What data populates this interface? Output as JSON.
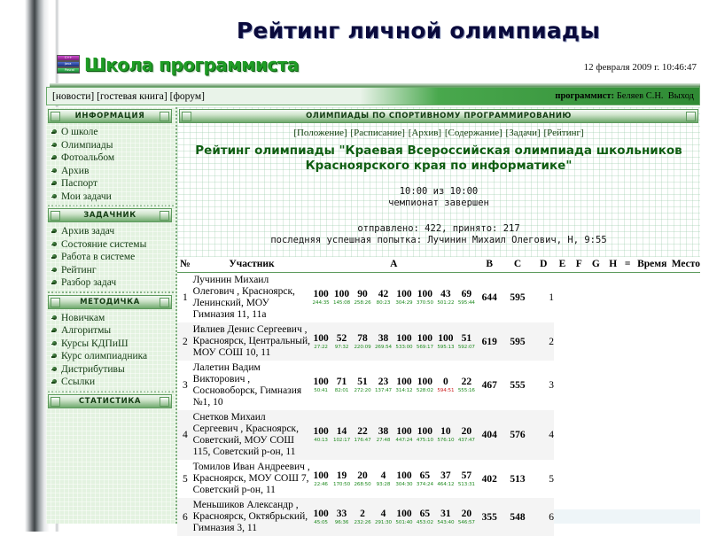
{
  "header": {
    "big_title": "Рейтинг личной олимпиады",
    "site_name": "Школа программиста",
    "datetime": "12 февраля 2009 г. 10:46:47",
    "logo_books": [
      "C++",
      "Java",
      "Pascal"
    ]
  },
  "topbar": {
    "left_links": "[новости] [гостевая книга] [форум]",
    "role_label": "программист:",
    "user_name": "Беляев С.Н.",
    "logout_label": "Выход"
  },
  "sidebar": {
    "sections": [
      {
        "title": "ИНФОРМАЦИЯ",
        "items": [
          "О школе",
          "Олимпиады",
          "Фотоальбом",
          "Архив",
          "Паспорт",
          "Мои задачи"
        ]
      },
      {
        "title": "ЗАДАЧНИК",
        "items": [
          "Архив задач",
          "Состояние системы",
          "Работа в системе",
          "Рейтинг",
          "Разбор задач"
        ]
      },
      {
        "title": "МЕТОДИЧКА",
        "items": [
          "Новичкам",
          "Алгоритмы",
          "Курсы КДПиШ",
          "Курс олимпиадника",
          "Дистрибутивы",
          "Ссылки"
        ]
      },
      {
        "title": "СТАТИСТИКА",
        "items": []
      }
    ]
  },
  "main": {
    "section_title": "ОЛИМПИАДЫ ПО СПОРТИВНОМУ ПРОГРАММИРОВАНИЮ",
    "subnav": [
      "[Положение]",
      "[Расписание]",
      "[Архив]",
      "[Содержание]",
      "[Задачи]",
      "[Рейтинг]"
    ],
    "olympiad_title": "Рейтинг олимпиады \"Краевая Всероссийская олимпиада школьников Красноярского края по информатике\"",
    "clock": "10:00 из 10:00",
    "status": "чемпионат завершен",
    "submissions": "отправлено: 422, принято: 217",
    "last_accepted": "последняя успешная попытка: Лучинин Михаил Олегович, H, 9:55"
  },
  "table": {
    "columns": [
      "№",
      "Участник",
      "A",
      "B",
      "C",
      "D",
      "E",
      "F",
      "G",
      "H",
      "=",
      "Время",
      "Место"
    ],
    "rows": [
      {
        "num": "1",
        "participant": "Лучинин Михаил Олегович , Красноярск, Ленинский, МОУ Гимназия 11, 11а",
        "scores": [
          "100",
          "100",
          "90",
          "42",
          "100",
          "100",
          "43",
          "69"
        ],
        "times": [
          "244:35",
          "145:08",
          "258:26",
          "80:23",
          "304:29",
          "370:50",
          "501:22",
          "595:44"
        ],
        "times_bad": [
          false,
          false,
          false,
          false,
          false,
          false,
          false,
          false
        ],
        "total": "644",
        "time": "595",
        "place": "1"
      },
      {
        "num": "2",
        "participant": "Ивлиев Денис Сергеевич , Красноярск, Центральный, МОУ СОШ 10, 11",
        "scores": [
          "100",
          "52",
          "78",
          "38",
          "100",
          "100",
          "100",
          "51"
        ],
        "times": [
          "27:22",
          "97:32",
          "220:09",
          "269:54",
          "533:00",
          "569:17",
          "595:13",
          "592:07"
        ],
        "times_bad": [
          false,
          false,
          false,
          false,
          false,
          false,
          false,
          false
        ],
        "total": "619",
        "time": "595",
        "place": "2"
      },
      {
        "num": "3",
        "participant": "Лалетин Вадим Викторович , Сосновоборск, Гимназия №1, 10",
        "scores": [
          "100",
          "71",
          "51",
          "23",
          "100",
          "100",
          "0",
          "22"
        ],
        "times": [
          "50:41",
          "82:01",
          "272:20",
          "137:47",
          "314:12",
          "528:02",
          "594:51",
          "555:16"
        ],
        "times_bad": [
          false,
          false,
          false,
          false,
          false,
          false,
          true,
          false
        ],
        "total": "467",
        "time": "555",
        "place": "3"
      },
      {
        "num": "4",
        "participant": "Снетков Михаил Сергеевич , Красноярск, Советский, МОУ СОШ 115, Советский р-он, 11",
        "scores": [
          "100",
          "14",
          "22",
          "38",
          "100",
          "100",
          "10",
          "20"
        ],
        "times": [
          "40:13",
          "102:17",
          "176:47",
          "27:48",
          "447:24",
          "475:10",
          "576:10",
          "437:47"
        ],
        "times_bad": [
          false,
          false,
          false,
          false,
          false,
          false,
          false,
          false
        ],
        "total": "404",
        "time": "576",
        "place": "4"
      },
      {
        "num": "5",
        "participant": "Томилов Иван Андреевич , Красноярск, МОУ СОШ 7, Советский р-он, 11",
        "scores": [
          "100",
          "19",
          "20",
          "4",
          "100",
          "65",
          "37",
          "57"
        ],
        "times": [
          "22:46",
          "170:50",
          "268:50",
          "93:28",
          "304:30",
          "374:24",
          "464:12",
          "513:31"
        ],
        "times_bad": [
          false,
          false,
          false,
          false,
          false,
          false,
          false,
          false
        ],
        "total": "402",
        "time": "513",
        "place": "5"
      },
      {
        "num": "6",
        "participant": "Меньшиков Александр , Красноярск, Октябрьский, Гимназия 3, 11",
        "scores": [
          "100",
          "33",
          "2",
          "4",
          "100",
          "65",
          "31",
          "20"
        ],
        "times": [
          "45:05",
          "96:36",
          "232:26",
          "291:30",
          "501:40",
          "453:02",
          "543:40",
          "546:57"
        ],
        "times_bad": [
          false,
          false,
          false,
          false,
          false,
          false,
          false,
          false
        ],
        "total": "355",
        "time": "548",
        "place": "6"
      }
    ]
  },
  "colors": {
    "brand_green": "#1f9c25",
    "title_navy": "#0a0a3c",
    "accent_bar": "#2f8a34",
    "time_good": "#1f8a1f",
    "time_bad": "#cc2222"
  }
}
